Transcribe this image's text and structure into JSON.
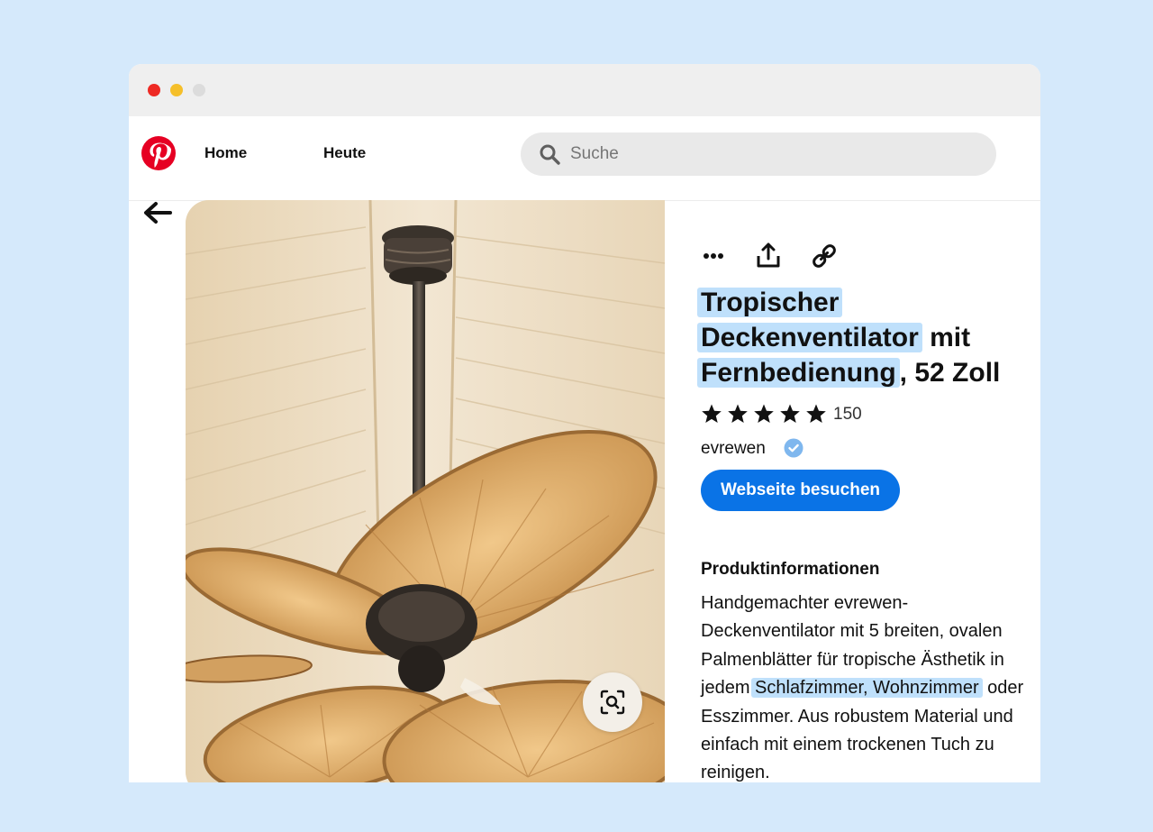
{
  "window": {
    "controls": [
      "close",
      "minimize",
      "maximize"
    ]
  },
  "navbar": {
    "logo_icon": "pinterest-logo",
    "links": [
      {
        "label": "Home"
      },
      {
        "label": "Heute"
      }
    ],
    "search": {
      "placeholder": "Suche",
      "value": "",
      "icon": "search-icon"
    }
  },
  "back_icon": "arrow-left-icon",
  "pin": {
    "image": {
      "subject": "tropical ceiling fan photo",
      "lens_icon": "visual-search-icon"
    },
    "actions": [
      {
        "icon": "more-icon"
      },
      {
        "icon": "share-icon"
      },
      {
        "icon": "link-icon"
      }
    ],
    "title": {
      "part1": "Tropischer",
      "part2": "Deckenventilator",
      "part3": " mit",
      "part4": "Fernbedienung",
      "part5": ", 52 Zoll"
    },
    "rating": {
      "stars": 5,
      "max": 5,
      "count": "150"
    },
    "creator": {
      "name": "evrewen",
      "verified": true
    },
    "visit_button": "Webseite besuchen",
    "info": {
      "heading": "Produktinformationen",
      "text1": "Handgemachter evrewen-Deckenventilator mit 5 breiten, ovalen Palmenblätter für tropische Ästhetik in jedem ",
      "text_highlight": "Schlafzimmer, Wohnzimmer",
      "text2": " oder Esszimmer. Aus robustem Material und einfach mit einem trockenen Tuch zu reinigen."
    }
  },
  "colors": {
    "background": "#d5e9fb",
    "highlight": "#bfe0fb",
    "brand_red": "#e60023",
    "button_blue": "#0a73e6",
    "verified_blue": "#7fb7ee"
  }
}
